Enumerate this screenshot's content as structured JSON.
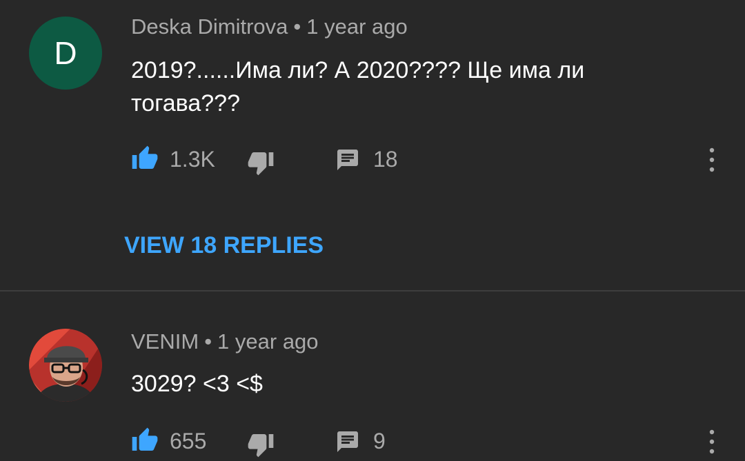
{
  "comments": [
    {
      "avatar_letter": "D",
      "avatar_color": "#0d5a43",
      "author": "Deska Dimitrova",
      "separator": "•",
      "time": "1 year ago",
      "text": "2019?......Има ли? А 2020???? Ще има ли тогава???",
      "likes": "1.3K",
      "replies": "18",
      "view_replies_label": "VIEW 18 REPLIES"
    },
    {
      "avatar_icon": "avatar-illustration",
      "author": "VENIM",
      "separator": "•",
      "time": "1 year ago",
      "text": "3029? <3 <$",
      "likes": "655",
      "replies": "9"
    }
  ],
  "colors": {
    "background": "#282828",
    "accent": "#3ea6ff",
    "like_active": "#3ea6ff",
    "secondary_text": "#aaaaaa"
  },
  "icons": {
    "like": "thumb-up-icon",
    "dislike": "thumb-down-icon",
    "reply": "comment-icon",
    "more": "more-vertical-icon"
  }
}
